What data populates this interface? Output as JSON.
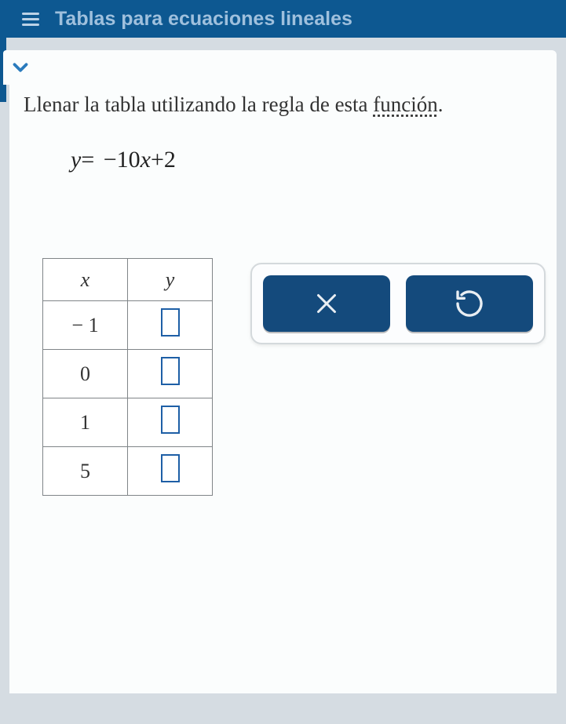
{
  "header": {
    "title": "Tablas para ecuaciones lineales"
  },
  "instruction": {
    "prefix": "Llenar la tabla utilizando la regla de esta ",
    "link": "función",
    "suffix": "."
  },
  "equation": {
    "lhs": "y",
    "eq": "=",
    "rhs_part1": "−",
    "rhs_part2": "10",
    "rhs_part3": "x",
    "rhs_part4": "+",
    "rhs_part5": "2"
  },
  "table": {
    "header_x": "x",
    "header_y": "y",
    "rows": [
      {
        "x": "− 1",
        "y": ""
      },
      {
        "x": "0",
        "y": ""
      },
      {
        "x": "1",
        "y": ""
      },
      {
        "x": "5",
        "y": ""
      }
    ]
  },
  "icons": {
    "expand": "chevron-down",
    "clear": "x",
    "reset": "undo"
  }
}
